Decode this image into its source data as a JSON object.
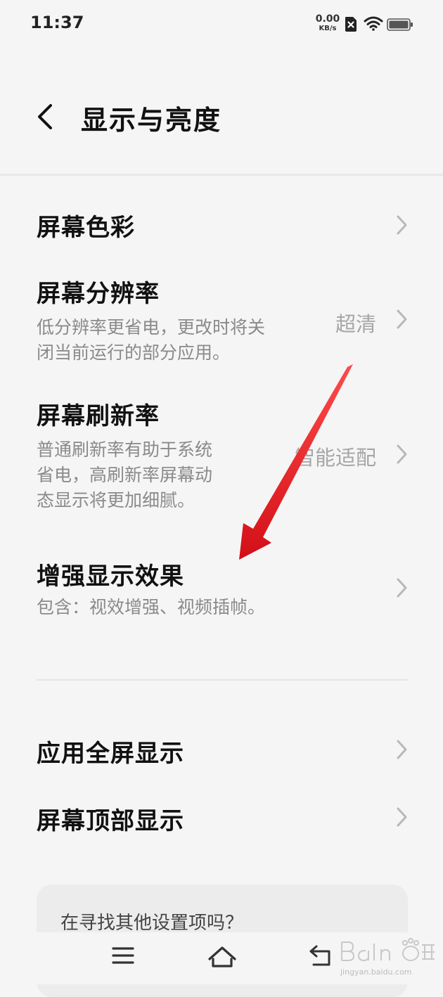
{
  "status_bar": {
    "time": "11:37",
    "net_speed_value": "0.00",
    "net_speed_unit": "KB/s",
    "icons": [
      "sim-error-icon",
      "wifi-icon",
      "battery-icon"
    ]
  },
  "header": {
    "title": "显示与亮度",
    "back_icon": "chevron-left-icon"
  },
  "items": [
    {
      "title": "屏幕色彩"
    },
    {
      "title": "屏幕分辨率",
      "desc_lines": [
        "低分辨率更省电，更改时将关",
        "闭当前运行的部分应用。"
      ],
      "value": "超清"
    },
    {
      "title": "屏幕刷新率",
      "desc_lines": [
        "普通刷新率有助于系统",
        "省电，高刷新率屏幕动",
        "态显示将更加细腻。"
      ],
      "value": "智能适配"
    },
    {
      "title": "增强显示效果",
      "desc_lines": [
        "包含：视效增强、视频插帧。"
      ]
    },
    {
      "title": "应用全屏显示"
    },
    {
      "title": "屏幕顶部显示"
    }
  ],
  "search_card": {
    "label": "在寻找其他设置项吗？"
  },
  "nav_bar": {
    "icons": [
      "menu-icon",
      "home-icon",
      "back-icon"
    ]
  },
  "watermark": {
    "sub": "jingyan.baidu.com"
  },
  "colors": {
    "annotation_arrow": "#e8141e",
    "background": "#f5f5f5"
  }
}
